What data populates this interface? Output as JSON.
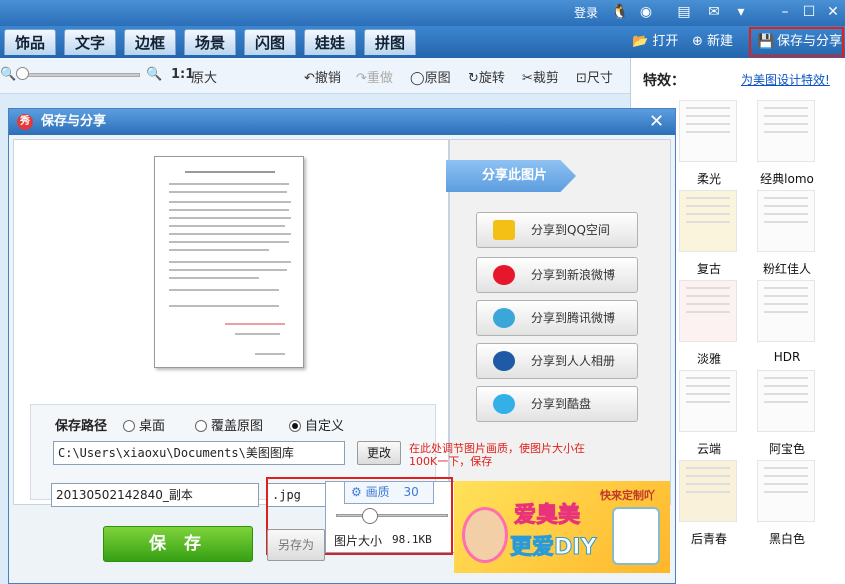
{
  "titlebar": {
    "login": "登录"
  },
  "tabs": [
    {
      "label": "饰品"
    },
    {
      "label": "文字"
    },
    {
      "label": "边框"
    },
    {
      "label": "场景"
    },
    {
      "label": "闪图"
    },
    {
      "label": "娃娃"
    },
    {
      "label": "拼图"
    }
  ],
  "top_actions": {
    "open": "打开",
    "new": "新建",
    "save_share": "保存与分享"
  },
  "toolbar": {
    "ratio": "1:1",
    "original_size": "原大",
    "undo": "撤销",
    "redo": "重做",
    "original": "原图",
    "rotate": "旋转",
    "crop": "裁剪",
    "resize": "尺寸"
  },
  "effects": {
    "header": "特效：",
    "link": "为美图设计特效!",
    "items": [
      "柔光",
      "经典lomo",
      "复古",
      "粉红佳人",
      "淡雅",
      "HDR",
      "云端",
      "阿宝色",
      "后青春",
      "黑白色"
    ]
  },
  "dialog": {
    "title": "保存与分享",
    "share_header": "分享此图片",
    "share_buttons": [
      "分享到QQ空间",
      "分享到新浪微博",
      "分享到腾讯微博",
      "分享到人人相册",
      "分享到酷盘"
    ],
    "path_label": "保存路径",
    "path_options": [
      "桌面",
      "覆盖原图",
      "自定义"
    ],
    "path_selected": "自定义",
    "path_value": "C:\\Users\\xiaoxu\\Documents\\美图图库",
    "change_button": "更改",
    "hint": "在此处调节图片画质，使图片大小在100K一下，保存",
    "filename": "20130502142840_副本",
    "format": ".jpg",
    "quality_label": "画质",
    "quality_value": "30",
    "quality_fraction": 0.3,
    "size_label": "图片大小",
    "size_value": "98.1KB",
    "save_button": "保 存",
    "save_as_button": "另存为",
    "ad_text1": "爱臭美",
    "ad_text2": "更爱DIY",
    "ad_text3": "快来定制吖"
  }
}
